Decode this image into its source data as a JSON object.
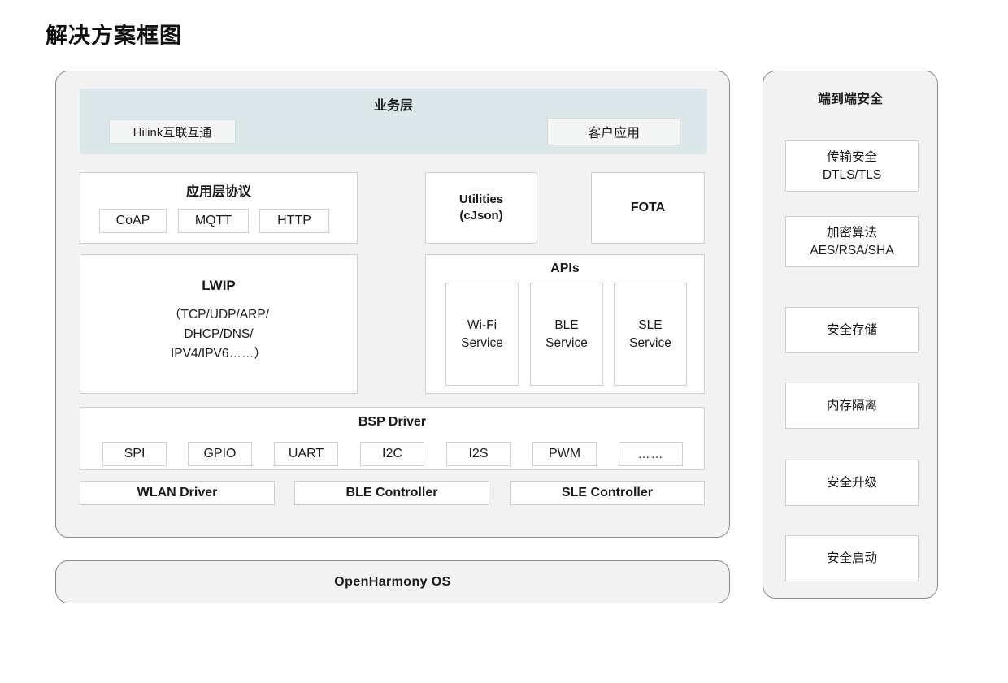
{
  "page": {
    "title": "解决方案框图"
  },
  "main_panel": {
    "business_layer": {
      "title": "业务层",
      "left_box": "Hilink互联互通",
      "right_box": "客户应用"
    },
    "app_protocol": {
      "title": "应用层协议",
      "chips": [
        "CoAP",
        "MQTT",
        "HTTP"
      ]
    },
    "utilities": {
      "line1": "Utilities",
      "line2": "(cJson)"
    },
    "fota": {
      "label": "FOTA"
    },
    "lwip": {
      "title": "LWIP",
      "line1": "（TCP/UDP/ARP/",
      "line2": "DHCP/DNS/",
      "line3": "IPV4/IPV6……）"
    },
    "apis": {
      "title": "APIs",
      "chips": [
        {
          "line1": "Wi-Fi",
          "line2": "Service"
        },
        {
          "line1": "BLE",
          "line2": "Service"
        },
        {
          "line1": "SLE",
          "line2": "Service"
        }
      ]
    },
    "bsp": {
      "title": "BSP Driver",
      "chips": [
        "SPI",
        "GPIO",
        "UART",
        "I2C",
        "I2S",
        "PWM",
        "……"
      ]
    },
    "controllers": [
      "WLAN Driver",
      "BLE Controller",
      "SLE Controller"
    ]
  },
  "security_panel": {
    "title": "端到端安全",
    "items": [
      {
        "line1": "传输安全",
        "line2": "DTLS/TLS"
      },
      {
        "line1": "加密算法",
        "line2": "AES/RSA/SHA"
      },
      {
        "line1": "安全存储",
        "line2": ""
      },
      {
        "line1": "内存隔离",
        "line2": ""
      },
      {
        "line1": "安全升级",
        "line2": ""
      },
      {
        "line1": "安全启动",
        "line2": ""
      }
    ]
  },
  "os_panel": {
    "label": "OpenHarmony OS"
  },
  "colors": {
    "business_band": "#dbe7e9",
    "panel_bg": "#f2f2f2",
    "box_bg": "#ffffff",
    "border": "#cfcfcf",
    "outer_border": "#8a8a8a"
  }
}
